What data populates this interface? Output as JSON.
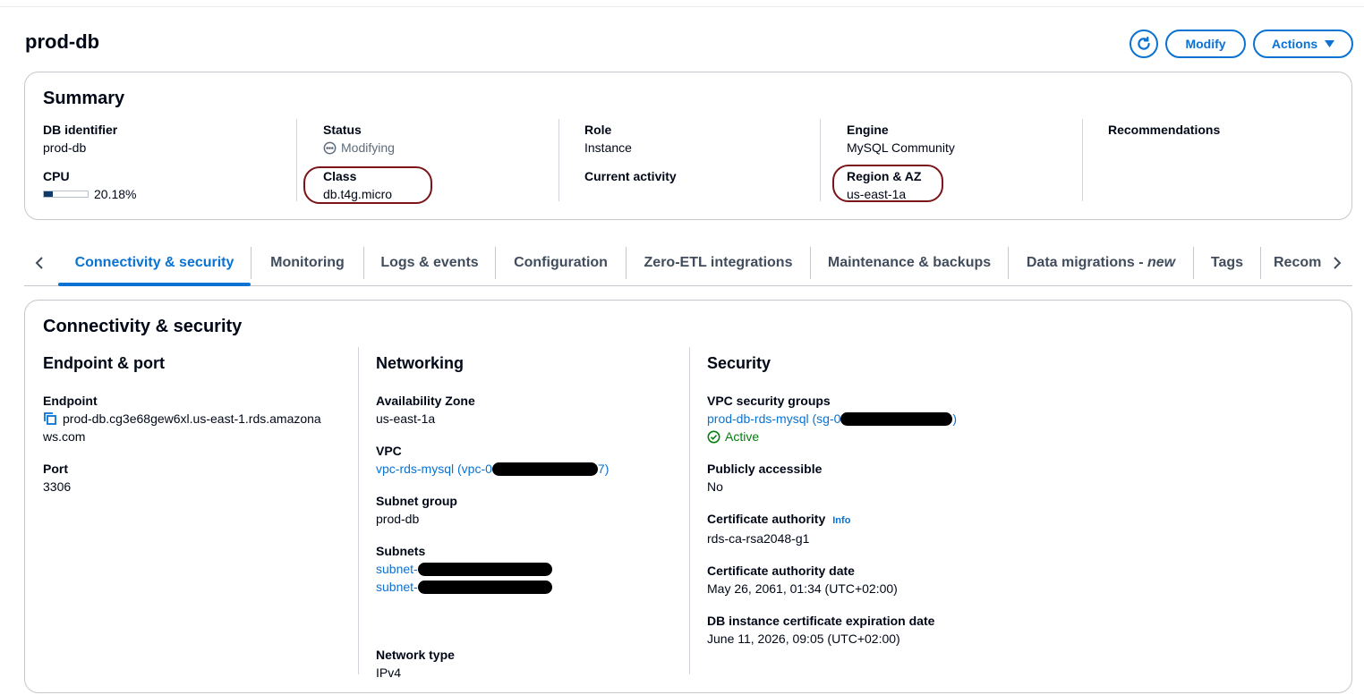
{
  "page": {
    "title": "prod-db"
  },
  "header": {
    "modify_label": "Modify",
    "actions_label": "Actions"
  },
  "summary": {
    "title": "Summary",
    "db_identifier": {
      "label": "DB identifier",
      "value": "prod-db"
    },
    "cpu": {
      "label": "CPU",
      "value": "20.18%",
      "fraction": 0.2018
    },
    "status": {
      "label": "Status",
      "value": "Modifying"
    },
    "class": {
      "label": "Class",
      "value": "db.t4g.micro"
    },
    "role": {
      "label": "Role",
      "value": "Instance"
    },
    "current_activity": {
      "label": "Current activity"
    },
    "engine": {
      "label": "Engine",
      "value": "MySQL Community"
    },
    "region": {
      "label": "Region & AZ",
      "value": "us-east-1a"
    },
    "recommendations": {
      "label": "Recommendations"
    }
  },
  "tabs": [
    {
      "label": "Connectivity & security",
      "active": true
    },
    {
      "label": "Monitoring"
    },
    {
      "label": "Logs & events"
    },
    {
      "label": "Configuration"
    },
    {
      "label": "Zero-ETL integrations"
    },
    {
      "label": "Maintenance & backups"
    },
    {
      "label": "Data migrations - ",
      "suffix": "new"
    },
    {
      "label": "Tags"
    },
    {
      "label": "Recommendations"
    }
  ],
  "connectivity": {
    "title": "Connectivity & security",
    "endpoint_port": {
      "title": "Endpoint & port",
      "endpoint_label": "Endpoint",
      "endpoint_line1": "prod-db.cg3e68gew6xl.us-east-1.rds.amazona",
      "endpoint_line2": "ws.com",
      "port_label": "Port",
      "port_value": "3306"
    },
    "networking": {
      "title": "Networking",
      "az_label": "Availability Zone",
      "az_value": "us-east-1a",
      "vpc_label": "VPC",
      "vpc_prefix": "vpc-rds-mysql (vpc-0",
      "vpc_suffix": "7)",
      "subnet_group_label": "Subnet group",
      "subnet_group_value": "prod-db",
      "subnets_label": "Subnets",
      "subnet_prefix": "subnet-",
      "network_type_label": "Network type",
      "network_type_value": "IPv4"
    },
    "security": {
      "title": "Security",
      "vpc_sg_label": "VPC security groups",
      "vpc_sg_prefix": "prod-db-rds-mysql (sg-0",
      "vpc_sg_suffix": ")",
      "sg_status": "Active",
      "public_label": "Publicly accessible",
      "public_value": "No",
      "ca_label": "Certificate authority",
      "ca_info": "Info",
      "ca_value": "rds-ca-rsa2048-g1",
      "ca_date_label": "Certificate authority date",
      "ca_date_value": "May 26, 2061, 01:34 (UTC+02:00)",
      "cert_exp_label": "DB instance certificate expiration date",
      "cert_exp_value": "June 11, 2026, 09:05 (UTC+02:00)"
    }
  },
  "colors": {
    "accent": "#0972d3",
    "success": "#037f0c",
    "highlight": "#7a1418"
  },
  "icons": [
    "refresh-icon",
    "caret-down-icon",
    "chevron-left-icon",
    "chevron-right-icon",
    "status-in-progress-icon",
    "copy-icon",
    "status-success-icon"
  ]
}
